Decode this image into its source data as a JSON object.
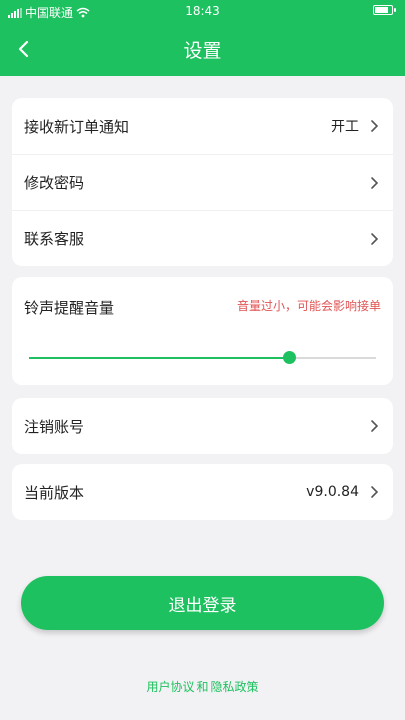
{
  "status_bar": {
    "carrier": "中国联通",
    "time": "18:43"
  },
  "nav": {
    "title": "设置"
  },
  "section1": {
    "items": [
      {
        "label": "接收新订单通知",
        "value": "开工"
      },
      {
        "label": "修改密码"
      },
      {
        "label": "联系客服"
      }
    ]
  },
  "volume": {
    "label": "铃声提醒音量",
    "warning": "音量过小，可能会影响接单",
    "level": 0.75
  },
  "deregister": {
    "label": "注销账号"
  },
  "version": {
    "label": "当前版本",
    "value": "v9.0.84"
  },
  "logout": {
    "label": "退出登录"
  },
  "footer": {
    "user_agreement": "用户协议",
    "connector": "和",
    "privacy": "隐私政策"
  },
  "colors": {
    "accent": "#1ec15f",
    "warning": "#e05454",
    "background": "#f2f2f4"
  }
}
